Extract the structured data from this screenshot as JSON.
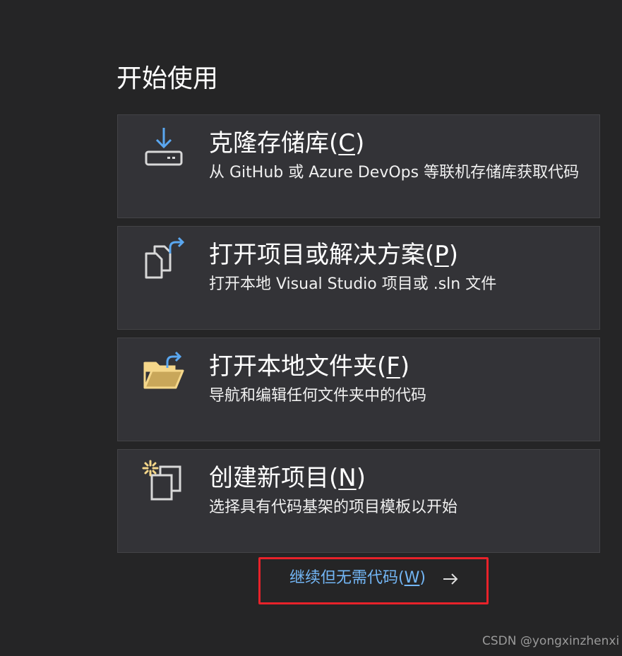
{
  "heading": "开始使用",
  "cards": [
    {
      "title_main": "克隆存储库(",
      "mnemonic": "C",
      "title_end": ")",
      "description": "从 GitHub 或 Azure DevOps 等联机存储库获取代码",
      "icon": "clone-download-icon"
    },
    {
      "title_main": "打开项目或解决方案(",
      "mnemonic": "P",
      "title_end": ")",
      "description": "打开本地 Visual Studio 项目或 .sln 文件",
      "icon": "open-project-icon"
    },
    {
      "title_main": "打开本地文件夹(",
      "mnemonic": "F",
      "title_end": ")",
      "description": "导航和编辑任何文件夹中的代码",
      "icon": "open-folder-icon"
    },
    {
      "title_main": "创建新项目(",
      "mnemonic": "N",
      "title_end": ")",
      "description": "选择具有代码基架的项目模板以开始",
      "icon": "new-project-icon"
    }
  ],
  "continue": {
    "label_main": "继续但无需代码(",
    "mnemonic": "W",
    "label_end": ")",
    "arrow_icon": "arrow-right-icon"
  },
  "watermark": "CSDN @yongxinzhenxi",
  "colors": {
    "background": "#252526",
    "card": "#333337",
    "card_border": "#434346",
    "link": "#73b6f5",
    "icon_blue": "#5aa7f0",
    "folder_yellow": "#f5d78a",
    "highlight_box": "#e8222a"
  }
}
